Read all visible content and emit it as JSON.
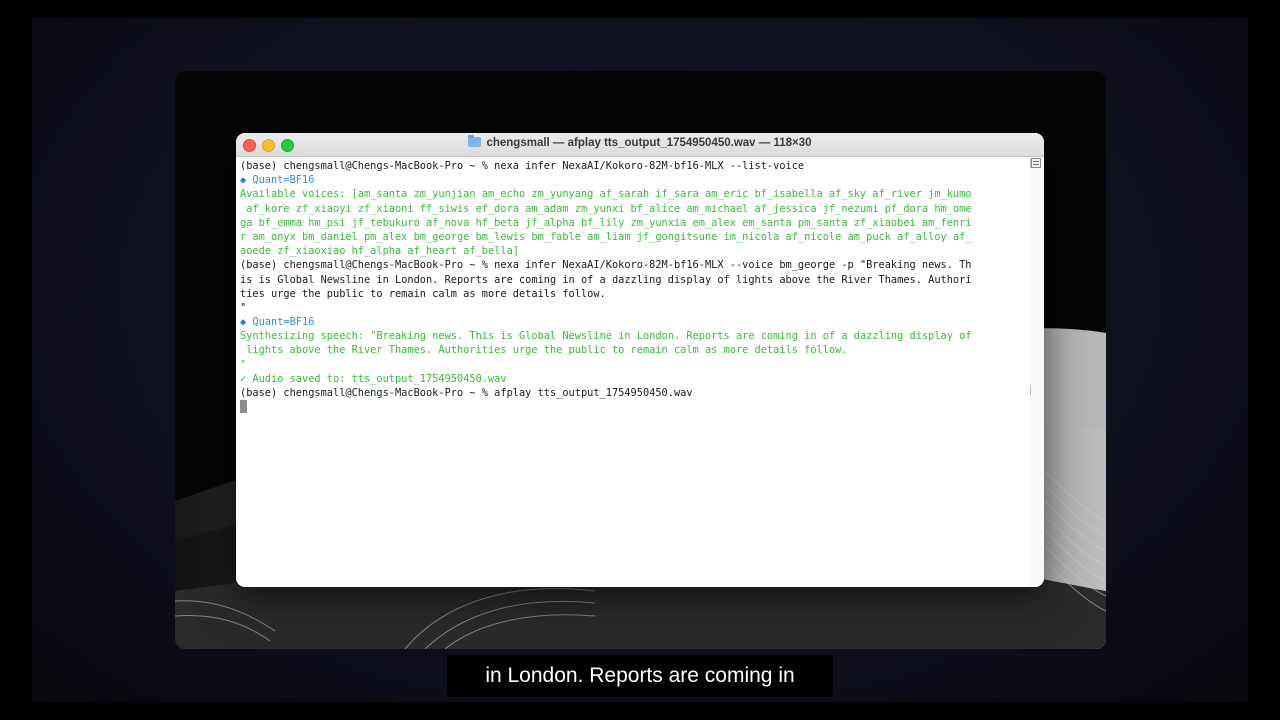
{
  "window": {
    "title": "chengsmall — afplay tts_output_1754950450.wav — 118×30",
    "folder_icon": "folder-icon"
  },
  "terminal": {
    "lines": [
      {
        "text": "(base) chengsmall@Chengs-MacBook-Pro ~ % nexa infer NexaAI/Kokoro-82M-bf16-MLX --list-voice",
        "color": "#1a1a1a"
      },
      {
        "text": " Quant=BF16",
        "color": "#3a8ad0",
        "icon": "diamond-icon"
      },
      {
        "text": "Available voices: [am_santa zm_yunjian am_echo zm_yunyang af_sarah if_sara am_eric bf_isabella af_sky af_river jm_kumo",
        "color": "#3cb93c"
      },
      {
        "text": " af_kore zf_xiaoyi zf_xiaoni ff_siwis ef_dora am_adam zm_yunxi bf_alice am_michael af_jessica jf_nezumi pf_dora hm_ome",
        "color": "#3cb93c"
      },
      {
        "text": "ga bf_emma hm_psi jf_tebukuro af_nova hf_beta jf_alpha bf_lily zm_yunxia em_alex em_santa pm_santa zf_xiaobei am_fenri",
        "color": "#3cb93c"
      },
      {
        "text": "r am_onyx bm_daniel pm_alex bm_george bm_lewis bm_fable am_liam jf_gongitsune im_nicola af_nicole am_puck af_alloy af_",
        "color": "#3cb93c"
      },
      {
        "text": "aoede zf_xiaoxiao hf_alpha af_heart af_bella]",
        "color": "#3cb93c"
      },
      {
        "text": "(base) chengsmall@Chengs-MacBook-Pro ~ % nexa infer NexaAI/Kokoro-82M-bf16-MLX --voice bm_george -p \"Breaking news. Th",
        "color": "#1a1a1a"
      },
      {
        "text": "is is Global Newsline in London. Reports are coming in of a dazzling display of lights above the River Thames. Authori",
        "color": "#1a1a1a"
      },
      {
        "text": "ties urge the public to remain calm as more details follow.",
        "color": "#1a1a1a"
      },
      {
        "text": "\"",
        "color": "#1a1a1a"
      },
      {
        "text": " Quant=BF16",
        "color": "#3a8ad0",
        "icon": "diamond-icon"
      },
      {
        "text": "Synthesizing speech: \"Breaking news. This is Global Newsline in London. Reports are coming in of a dazzling display of",
        "color": "#3cb93c"
      },
      {
        "text": " lights above the River Thames. Authorities urge the public to remain calm as more details follow.",
        "color": "#3cb93c"
      },
      {
        "text": "\"",
        "color": "#3cb93c"
      },
      {
        "text": "✓ Audio saved to: tts_output_1754950450.wav",
        "color": "#3cb93c"
      },
      {
        "text": "(base) chengsmall@Chengs-MacBook-Pro ~ % afplay tts_output_1754950450.wav",
        "color": "#1a1a1a"
      }
    ]
  },
  "subtitle": {
    "text": "in London. Reports are coming in"
  }
}
